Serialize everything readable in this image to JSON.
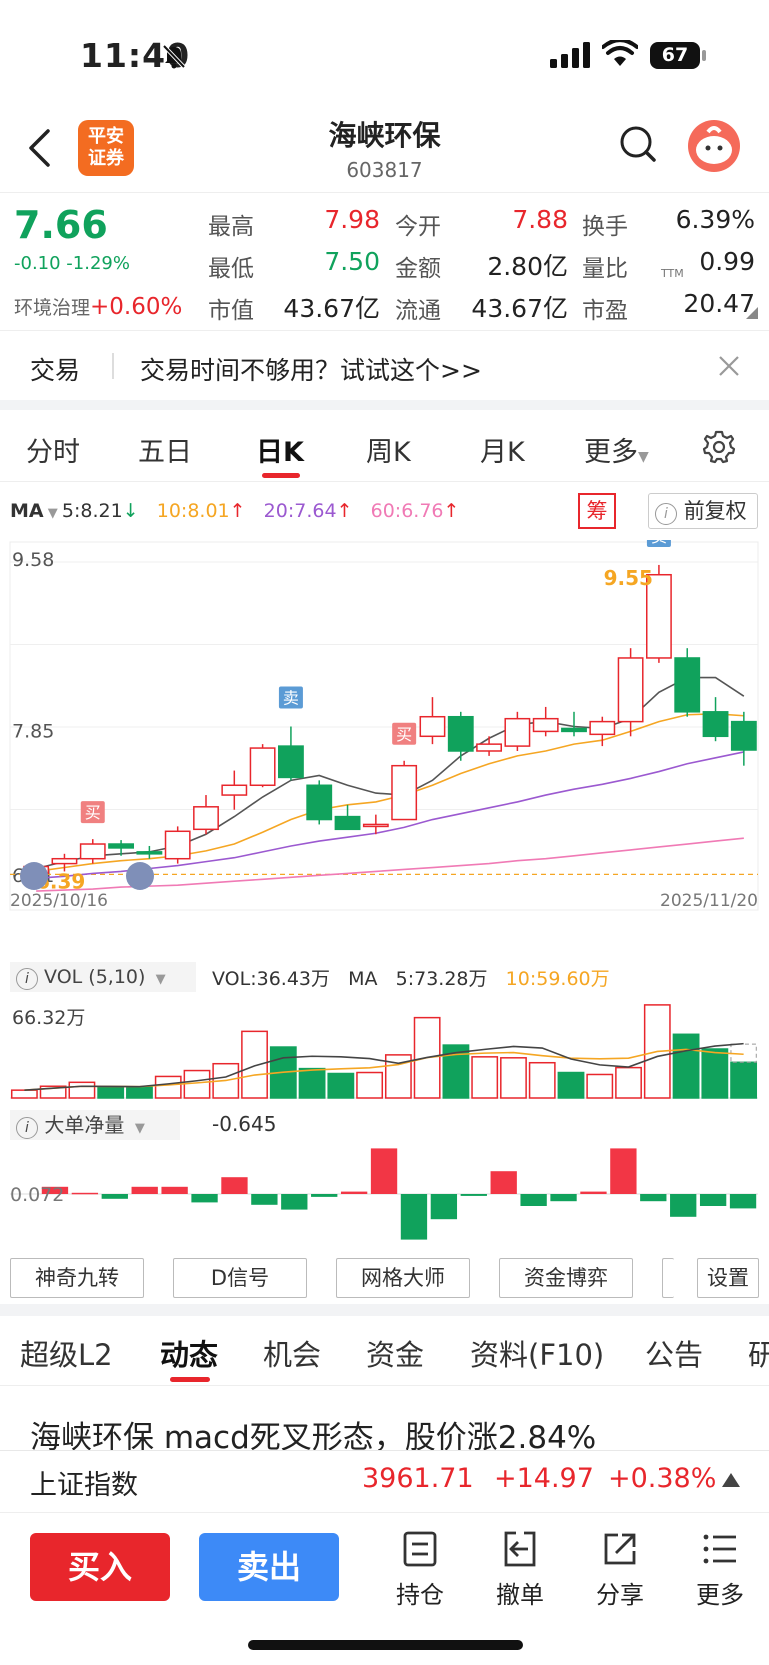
{
  "status": {
    "time": "11:40",
    "battery": "67"
  },
  "header": {
    "back_icon": "chevron-left-icon",
    "logo_line1": "平安",
    "logo_line2": "证券",
    "title": "海峡环保",
    "code": "603817"
  },
  "quote": {
    "price": "7.66",
    "change": "-0.10 -1.29%",
    "sector_name": "环境治理",
    "sector_change": "+0.60%",
    "fields": [
      {
        "label": "最高",
        "value": "7.98",
        "color": "#e8262c"
      },
      {
        "label": "今开",
        "value": "7.88",
        "color": "#e8262c"
      },
      {
        "label": "换手",
        "value": "6.39%",
        "color": "#222222"
      },
      {
        "label": "最低",
        "value": "7.50",
        "color": "#10a25c"
      },
      {
        "label": "金额",
        "value": "2.80亿",
        "color": "#222222"
      },
      {
        "label": "量比",
        "value": "0.99",
        "color": "#222222"
      },
      {
        "label": "市值",
        "value": "43.67亿",
        "color": "#222222"
      },
      {
        "label": "流通",
        "value": "43.67亿",
        "color": "#222222"
      },
      {
        "label": "市盈",
        "value": "20.47",
        "color": "#222222"
      }
    ],
    "pe_suffix": "TTM"
  },
  "notice": {
    "tag": "交易",
    "text": "交易时间不够用？试试这个>>"
  },
  "period_tabs": [
    "分时",
    "五日",
    "日K",
    "周K",
    "月K",
    "更多"
  ],
  "active_period": "日K",
  "ma_legend": {
    "label": "MA",
    "ma5": "5:8.21",
    "ma10": "10:8.01",
    "ma20": "20:7.64",
    "ma60": "60:6.76",
    "chip_button": "筹",
    "adjust": "前复权"
  },
  "chart_data": {
    "type": "candlestick",
    "x_start": "2025/10/16",
    "x_end": "2025/11/20",
    "y_labels": [
      "9.58",
      "7.85",
      "6.21"
    ],
    "ylim": [
      6.21,
      9.58
    ],
    "max_marker": "9.55",
    "min_marker": "6.39",
    "candles": [
      {
        "o": 6.4,
        "h": 6.5,
        "l": 6.33,
        "c": 6.47
      },
      {
        "o": 6.5,
        "h": 6.6,
        "l": 6.42,
        "c": 6.55
      },
      {
        "o": 6.55,
        "h": 6.75,
        "l": 6.5,
        "c": 6.7
      },
      {
        "o": 6.7,
        "h": 6.74,
        "l": 6.58,
        "c": 6.66
      },
      {
        "o": 6.62,
        "h": 6.68,
        "l": 6.55,
        "c": 6.6
      },
      {
        "o": 6.55,
        "h": 6.88,
        "l": 6.5,
        "c": 6.83
      },
      {
        "o": 6.85,
        "h": 7.2,
        "l": 6.8,
        "c": 7.08
      },
      {
        "o": 7.2,
        "h": 7.45,
        "l": 7.05,
        "c": 7.3
      },
      {
        "o": 7.3,
        "h": 7.72,
        "l": 7.28,
        "c": 7.68
      },
      {
        "o": 7.7,
        "h": 7.9,
        "l": 7.35,
        "c": 7.38
      },
      {
        "o": 7.3,
        "h": 7.35,
        "l": 6.9,
        "c": 6.95
      },
      {
        "o": 6.98,
        "h": 7.1,
        "l": 6.85,
        "c": 6.85
      },
      {
        "o": 6.9,
        "h": 7.0,
        "l": 6.8,
        "c": 6.9
      },
      {
        "o": 6.95,
        "h": 7.55,
        "l": 6.95,
        "c": 7.5
      },
      {
        "o": 7.8,
        "h": 8.2,
        "l": 7.72,
        "c": 8.0
      },
      {
        "o": 8.0,
        "h": 8.05,
        "l": 7.55,
        "c": 7.65
      },
      {
        "o": 7.65,
        "h": 7.8,
        "l": 7.6,
        "c": 7.72
      },
      {
        "o": 7.7,
        "h": 8.05,
        "l": 7.65,
        "c": 7.98
      },
      {
        "o": 7.85,
        "h": 8.1,
        "l": 7.8,
        "c": 7.98
      },
      {
        "o": 7.88,
        "h": 8.05,
        "l": 7.8,
        "c": 7.85
      },
      {
        "o": 7.82,
        "h": 8.0,
        "l": 7.7,
        "c": 7.95
      },
      {
        "o": 7.95,
        "h": 8.7,
        "l": 7.8,
        "c": 8.6
      },
      {
        "o": 8.6,
        "h": 9.55,
        "l": 8.55,
        "c": 9.45
      },
      {
        "o": 8.6,
        "h": 8.7,
        "l": 8.0,
        "c": 8.05
      },
      {
        "o": 8.05,
        "h": 8.2,
        "l": 7.75,
        "c": 7.8
      },
      {
        "o": 7.95,
        "h": 8.05,
        "l": 7.5,
        "c": 7.66
      }
    ],
    "ma5_line": [
      6.45,
      6.52,
      6.58,
      6.6,
      6.62,
      6.68,
      6.8,
      6.98,
      7.18,
      7.35,
      7.4,
      7.3,
      7.22,
      7.2,
      7.35,
      7.6,
      7.78,
      7.92,
      7.95,
      7.9,
      7.88,
      7.98,
      8.25,
      8.4,
      8.4,
      8.21
    ],
    "ma10_line": [
      6.42,
      6.46,
      6.5,
      6.53,
      6.55,
      6.58,
      6.63,
      6.7,
      6.82,
      6.95,
      7.05,
      7.1,
      7.13,
      7.2,
      7.3,
      7.42,
      7.52,
      7.6,
      7.65,
      7.72,
      7.76,
      7.85,
      7.95,
      8.02,
      8.03,
      8.01
    ],
    "ma20_line": [
      6.35,
      6.37,
      6.4,
      6.42,
      6.45,
      6.48,
      6.52,
      6.56,
      6.62,
      6.68,
      6.73,
      6.77,
      6.81,
      6.87,
      6.95,
      7.01,
      7.07,
      7.13,
      7.2,
      7.26,
      7.31,
      7.37,
      7.44,
      7.52,
      7.58,
      7.64
    ],
    "ma60_line": [
      6.22,
      6.23,
      6.24,
      6.26,
      6.27,
      6.28,
      6.3,
      6.32,
      6.34,
      6.36,
      6.38,
      6.4,
      6.42,
      6.44,
      6.46,
      6.48,
      6.5,
      6.53,
      6.55,
      6.58,
      6.61,
      6.64,
      6.67,
      6.7,
      6.73,
      6.76
    ],
    "signals": [
      {
        "i": 2,
        "text": "买",
        "kind": "buy"
      },
      {
        "i": 9,
        "text": "卖",
        "kind": "sell"
      },
      {
        "i": 13,
        "text": "买",
        "kind": "buy"
      },
      {
        "i": 22,
        "text": "卖",
        "kind": "sell"
      }
    ]
  },
  "volume": {
    "title": "VOL (5,10)",
    "vol": "VOL:36.43万",
    "ma_label": "MA",
    "ma5": "5:73.28万",
    "ma10": "10:59.60万",
    "y_label": "66.32万",
    "values": [
      8,
      12,
      16,
      11,
      11,
      22,
      28,
      35,
      68,
      52,
      30,
      25,
      26,
      44,
      82,
      54,
      42,
      41,
      36,
      26,
      24,
      31,
      95,
      65,
      50,
      36.43
    ]
  },
  "bigorder": {
    "title": "大单净量",
    "value": "-0.645",
    "y_label": "0.072",
    "values": [
      0.3,
      0.05,
      -0.2,
      0.3,
      0.3,
      -0.35,
      0.7,
      -0.45,
      -0.65,
      -0.12,
      0.1,
      1.9,
      -1.9,
      -1.05,
      -0.08,
      0.95,
      -0.5,
      -0.3,
      0.1,
      1.9,
      -0.3,
      -0.95,
      -0.5,
      -0.6
    ]
  },
  "indicator_buttons": [
    "神奇九转",
    "D信号",
    "网格大师",
    "资金博弈",
    "设置"
  ],
  "bottom_tabs": [
    "超级L2",
    "动态",
    "机会",
    "资金",
    "资料(F10)",
    "公告",
    "研"
  ],
  "active_bottom_tab": "动态",
  "news_headline": "海峡环保 macd死叉形态，股价涨2.84%",
  "index_bar": {
    "name": "上证指数",
    "value": "3961.71",
    "change": "+14.97",
    "pct": "+0.38%"
  },
  "actions": {
    "buy": "买入",
    "sell": "卖出",
    "tools": [
      {
        "label": "持仓",
        "icon": "holdings-icon"
      },
      {
        "label": "撤单",
        "icon": "cancel-order-icon"
      },
      {
        "label": "分享",
        "icon": "share-icon"
      },
      {
        "label": "更多",
        "icon": "menu-icon"
      }
    ]
  }
}
